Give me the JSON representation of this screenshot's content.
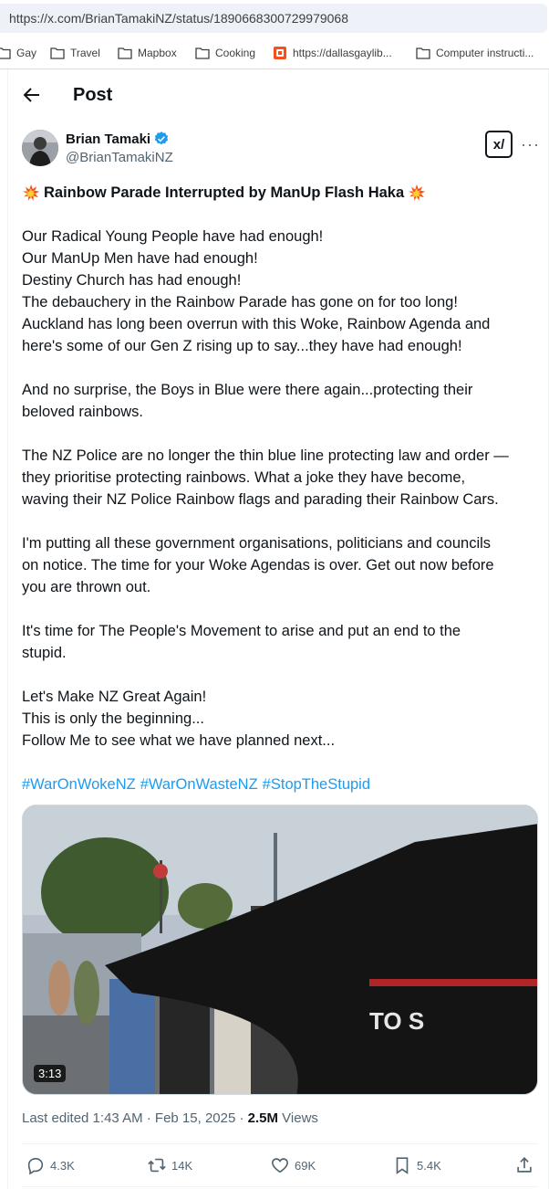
{
  "browser": {
    "url": "https://x.com/BrianTamakiNZ/status/1890668300729979068",
    "bookmarks": [
      {
        "label": "Gay",
        "icon": "folder-icon"
      },
      {
        "label": "Travel",
        "icon": "folder-icon"
      },
      {
        "label": "Mapbox",
        "icon": "folder-icon"
      },
      {
        "label": "Cooking",
        "icon": "folder-icon"
      },
      {
        "label": "https://dallasgaylib...",
        "icon": "bookmark-site-icon"
      },
      {
        "label": "Computer instructi...",
        "icon": "folder-icon"
      }
    ]
  },
  "header": {
    "title": "Post",
    "back_icon": "back-arrow-icon"
  },
  "author": {
    "name": "Brian Tamaki",
    "handle": "@BrianTamakiNZ",
    "verified": true,
    "grok_label": "x/"
  },
  "post": {
    "title": "Rainbow Parade Interrupted by ManUp Flash Haka",
    "paragraphs": [
      [
        "Our Radical Young People have had enough!",
        "Our ManUp Men have had enough!",
        "Destiny Church has had enough!",
        "The debauchery in the Rainbow Parade has gone on for too long!",
        "Auckland has long been overrun with this Woke, Rainbow Agenda and",
        "here's some of our Gen Z rising up to say...they have had enough!"
      ],
      [
        "And no surprise, the Boys in Blue were there again...protecting their",
        "beloved rainbows."
      ],
      [
        "The NZ Police are no longer the thin blue line protecting law and order —",
        "they prioritise protecting rainbows. What a joke they have become,",
        "waving their NZ Police Rainbow flags and parading their Rainbow Cars."
      ],
      [
        "I'm putting all these government organisations, politicians and councils",
        "on notice.  The time for your Woke Agendas is over. Get out now before",
        "you are thrown out."
      ],
      [
        "It's time for The People's Movement to arise and put an end to the",
        "stupid."
      ],
      [
        "Let's Make NZ Great Again!",
        "This is only the beginning...",
        "Follow Me to see what we have planned next..."
      ]
    ],
    "hashtags": [
      "#WarOnWokeNZ",
      "#WarOnWasteNZ",
      "#StopTheStupid"
    ],
    "video_duration": "3:13"
  },
  "meta": {
    "edited": "Last edited 1:43 AM · Feb 15, 2025 · ",
    "views_count": "2.5M",
    "views_label": " Views"
  },
  "actions": {
    "replies": "4.3K",
    "reposts": "14K",
    "likes": "69K",
    "bookmarks": "5.4K"
  }
}
